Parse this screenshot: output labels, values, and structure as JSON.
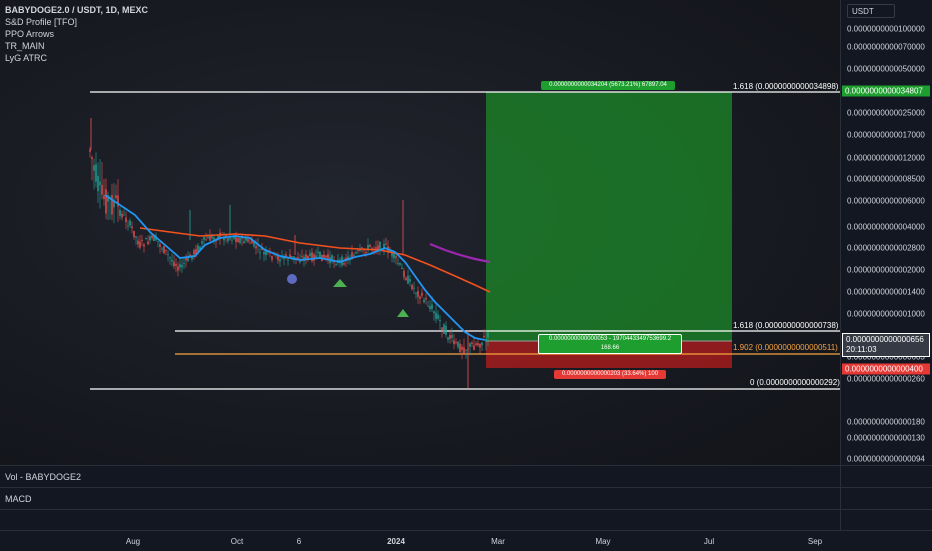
{
  "legend": {
    "title": "BABYDOGE2.0 / USDT, 1D, MEXC",
    "indicators": [
      "S&D Profile [TFO]",
      "PPO Arrows",
      "TR_MAIN",
      "LyG ATRC"
    ]
  },
  "currency_button": "USDT",
  "price_ticks": [
    "0.0000000000100000",
    "0.0000000000070000",
    "0.0000000000050000",
    "0.0000000000025000",
    "0.0000000000017000",
    "0.0000000000012000",
    "0.0000000000008500",
    "0.0000000000006000",
    "0.0000000000004000",
    "0.0000000000002800",
    "0.0000000000002000",
    "0.0000000000001400",
    "0.0000000000001000",
    "0.0000000000000603",
    "0.0000000000000260",
    "0.0000000000000180",
    "0.0000000000000130",
    "0.0000000000000094"
  ],
  "price_tags": {
    "target": "0.0000000000034807",
    "current": "0.0000000000000656",
    "countdown": "20:11:03",
    "stop": "0.0000000000000400"
  },
  "fib_levels": [
    {
      "label": "1.618 (0.0000000000034898)",
      "color": "#ffffff"
    },
    {
      "label": "1.618 (0.0000000000000738)",
      "color": "#ffffff"
    },
    {
      "label": "1.902 (0.0000000000000511)",
      "color": "#f7a440"
    },
    {
      "label": "0 (0.0000000000000292)",
      "color": "#ffffff"
    }
  ],
  "position": {
    "target_label": "0.0000000000034204 (5673.21%) 67897.04",
    "center_line1": "0.0000000000000053 - 1970443349753699.2",
    "center_line2": "168.66",
    "stop_label": "0.0000000000000203 (33.64%) 100"
  },
  "panes": {
    "volume": "Vol - BABYDOGE2",
    "macd": "MACD"
  },
  "time_labels": [
    "Aug",
    "Oct",
    "6",
    "2024",
    "Mar",
    "May",
    "Jul",
    "Sep"
  ],
  "colors": {
    "bg": "#131722",
    "bull": "#26a69a",
    "bear": "#ef5350",
    "ema_fast": "#2196f3",
    "ema_slow": "#f4511e",
    "purple": "#9c27b0",
    "target_zone": "#1b7f26",
    "stop_zone": "#8b1a1a",
    "fib_orange": "#f7a440"
  }
}
